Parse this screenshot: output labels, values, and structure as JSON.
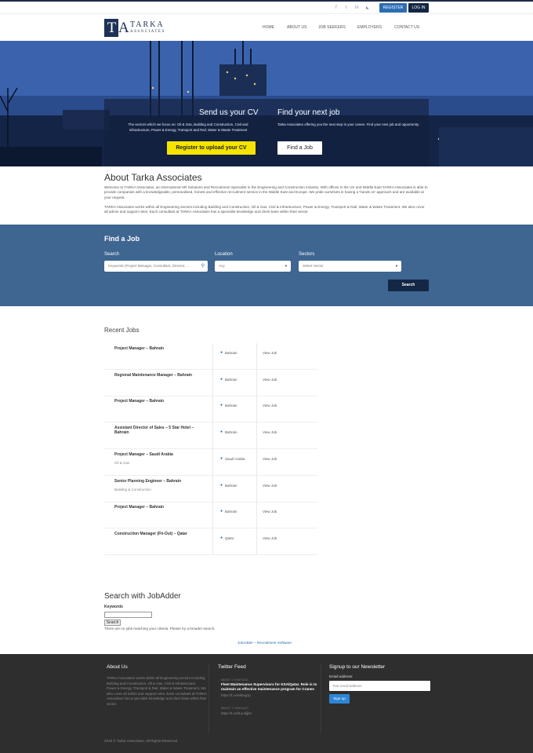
{
  "topbar": {
    "social_icons": [
      "facebook-icon",
      "twitter-icon",
      "linkedin-icon",
      "rss-icon"
    ],
    "social_glyphs": [
      "f",
      "t",
      "in",
      "◣"
    ],
    "register_label": "REGISTER",
    "login_label": "LOG IN"
  },
  "logo": {
    "letters": "T",
    "letter_a": "A",
    "name": "TARKA",
    "sub": "ASSOCIATES"
  },
  "nav": [
    "HOME",
    "ABOUT US",
    "JOB SEEKERS",
    "EMPLOYERS",
    "CONTACT US"
  ],
  "hero": {
    "left_title": "Send us your CV",
    "left_text": "The sectors which we focus on: Oil & Gas, Building and Construction, Civil and Infrastructure, Power & Energy, Transport and Rail, Water & Waste Treatment",
    "left_button": "Register to upload your CV",
    "right_title": "Find your next job",
    "right_text": "Tarka Associates offering you the next step in your career. Find your next job and opportunity.",
    "right_button": "Find a Job"
  },
  "about": {
    "title": "About Tarka Associates",
    "p1": "Welcome to TARKA Associates, an International HR Solutions and Recruitment Specialist in the Engineering and Construction Industry. With offices in the UK and Middle East TARKA Associates is able to provide companies with a knowledgeable, personalised, honest and effective recruitment service in the Middle East and Europe. We pride ourselves in having a 'hands on' approach and are available at your request.",
    "p2": "TARKA Associates works within all Engineering sectors including Building and Construction, Oil & Gas, Civil & Infrastructure, Power & Energy, Transport & Rail, Water & Waste Treatment. We also cover all admin and support roles. Each consultant at TARKA Associates has a specialist knowledge and client base within their sector."
  },
  "find": {
    "title": "Find a Job",
    "search_label": "Search",
    "search_placeholder": "Keywords (Project Manager, Consultant, Director, ...",
    "location_label": "Location",
    "location_value": "Any",
    "sectors_label": "Sectors",
    "sectors_value": "Select Sector",
    "search_button": "Search"
  },
  "recent": {
    "title": "Recent Jobs",
    "jobs": [
      {
        "title": "Project Manager – Bahrain",
        "sector": "",
        "location": "Bahrain",
        "view": "View Job"
      },
      {
        "title": "Regional Maintenance Manager – Bahrain",
        "sector": "",
        "location": "Bahrain",
        "view": "View Job"
      },
      {
        "title": "Project Manager – Bahrain",
        "sector": "",
        "location": "Bahrain",
        "view": "View Job"
      },
      {
        "title": "Assistant Director of Sales – 5 Star Hotel – Bahrain",
        "sector": "",
        "location": "Bahrain",
        "view": "View Job"
      },
      {
        "title": "Project Manager – Saudi Arabia",
        "sector": "Oil & Gas",
        "location": "Saudi Arabia",
        "view": "View Job"
      },
      {
        "title": "Senior Planning Engineer – Bahrain",
        "sector": "Building & Construction",
        "location": "Bahrain",
        "view": "View Job"
      },
      {
        "title": "Project Manager – Bahrain",
        "sector": "",
        "location": "Bahrain",
        "view": "View Job"
      },
      {
        "title": "Construction Manager (Fit-Out) – Qatar",
        "sector": "",
        "location": "Qatar",
        "view": "View Job"
      }
    ]
  },
  "jobadder": {
    "title": "Search with JobAdder",
    "keywords_label": "Keywords",
    "keywords_value": "",
    "search_button": "Search",
    "note": "There are no jobs matching your criteria. Please try a broader search.",
    "link": "JobAdder – Recruitment Software"
  },
  "footer": {
    "about_title": "About Us",
    "about_text": "TARKA Associates works within all Engineering sectors including Building and Construction, Oil & Gas, Civil & Infrastructure, Power & Energy, Transport & Rail, Water & Waste Treatment. We also cover all admin and support roles. Each consultant at TARKA Associates has a specialist knowledge and client base within their sector.",
    "twitter_title": "Twitter Feed",
    "tweets": [
      {
        "time": "ABOUT 1 YEAR AGO",
        "text": "Fleet Maintenance Supervisors for KSA/Qatar. Role is to maintain an effective maintenance program for Cranes",
        "link": "https://t.co/ekbxgzp"
      },
      {
        "time": "ABOUT 1 YEAR AGO",
        "text": "",
        "link": "https://t.co/l1ourfjjbn"
      }
    ],
    "newsletter_title": "Signup to our Newsletter",
    "email_label": "Email address:",
    "email_placeholder": "Your email address",
    "signup_button": "Sign up",
    "copyright": "2015 © Tarka Associates, All Rights Reserved"
  },
  "colors": {
    "navy": "#132744",
    "accent_blue": "#2d6db3",
    "find_bg": "#3f6591",
    "yellow": "#f5e400",
    "footer_bg": "#2e2e2e"
  }
}
